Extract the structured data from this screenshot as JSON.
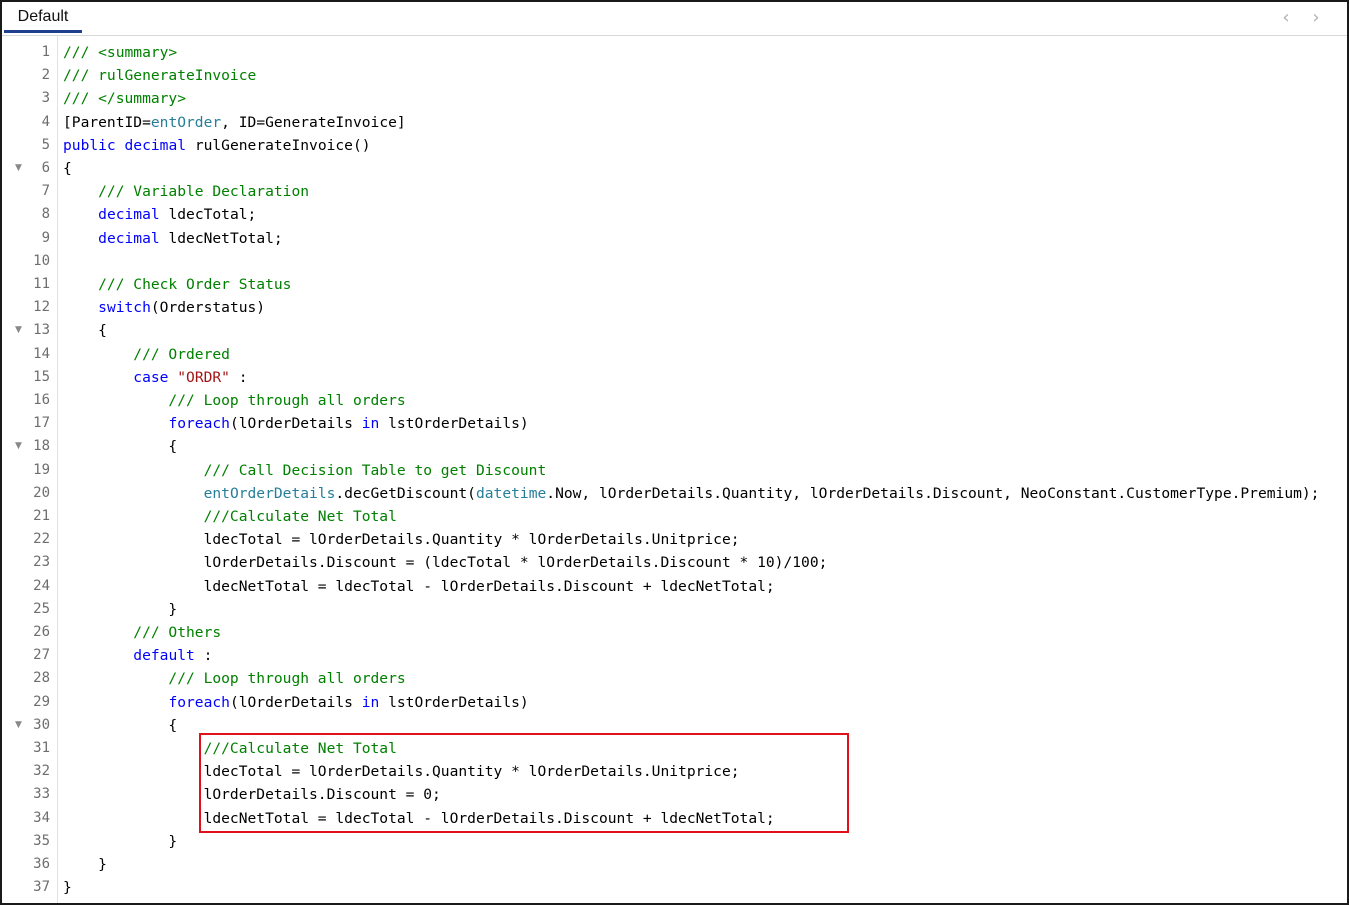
{
  "tab": {
    "label": "Default"
  },
  "nav": {
    "prev_icon": "chevron-left-icon",
    "next_icon": "chevron-right-icon"
  },
  "colors": {
    "comment": "#008000",
    "keyword": "#0000ff",
    "type": "#267f99",
    "string": "#a31515",
    "highlight_border": "#e0111b",
    "tab_underline": "#1f3f8f"
  },
  "lines": [
    {
      "n": "1",
      "fold": false,
      "tokens": [
        {
          "t": "/// <summary>",
          "c": "comment"
        }
      ]
    },
    {
      "n": "2",
      "fold": false,
      "tokens": [
        {
          "t": "/// rulGenerateInvoice",
          "c": "comment"
        }
      ]
    },
    {
      "n": "3",
      "fold": false,
      "tokens": [
        {
          "t": "/// </summary>",
          "c": "comment"
        }
      ]
    },
    {
      "n": "4",
      "fold": false,
      "tokens": [
        {
          "t": "[ParentID=",
          "c": "plain"
        },
        {
          "t": "entOrder",
          "c": "type"
        },
        {
          "t": ", ID=GenerateInvoice]",
          "c": "plain"
        }
      ]
    },
    {
      "n": "5",
      "fold": false,
      "tokens": [
        {
          "t": "public",
          "c": "keyword"
        },
        {
          "t": " ",
          "c": "plain"
        },
        {
          "t": "decimal",
          "c": "keyword"
        },
        {
          "t": " rulGenerateInvoice()",
          "c": "plain"
        }
      ]
    },
    {
      "n": "6",
      "fold": true,
      "tokens": [
        {
          "t": "{",
          "c": "plain"
        }
      ]
    },
    {
      "n": "7",
      "fold": false,
      "tokens": [
        {
          "t": "    /// Variable Declaration",
          "c": "comment"
        }
      ]
    },
    {
      "n": "8",
      "fold": false,
      "tokens": [
        {
          "t": "    ",
          "c": "plain"
        },
        {
          "t": "decimal",
          "c": "keyword"
        },
        {
          "t": " ldecTotal;",
          "c": "plain"
        }
      ]
    },
    {
      "n": "9",
      "fold": false,
      "tokens": [
        {
          "t": "    ",
          "c": "plain"
        },
        {
          "t": "decimal",
          "c": "keyword"
        },
        {
          "t": " ldecNetTotal;",
          "c": "plain"
        }
      ]
    },
    {
      "n": "10",
      "fold": false,
      "tokens": []
    },
    {
      "n": "11",
      "fold": false,
      "tokens": [
        {
          "t": "    /// Check Order Status",
          "c": "comment"
        }
      ]
    },
    {
      "n": "12",
      "fold": false,
      "tokens": [
        {
          "t": "    ",
          "c": "plain"
        },
        {
          "t": "switch",
          "c": "keyword"
        },
        {
          "t": "(Orderstatus)",
          "c": "plain"
        }
      ]
    },
    {
      "n": "13",
      "fold": true,
      "tokens": [
        {
          "t": "    {",
          "c": "plain"
        }
      ]
    },
    {
      "n": "14",
      "fold": false,
      "tokens": [
        {
          "t": "        /// Ordered",
          "c": "comment"
        }
      ]
    },
    {
      "n": "15",
      "fold": false,
      "tokens": [
        {
          "t": "        ",
          "c": "plain"
        },
        {
          "t": "case",
          "c": "keyword"
        },
        {
          "t": " ",
          "c": "plain"
        },
        {
          "t": "\"ORDR\"",
          "c": "string"
        },
        {
          "t": " :",
          "c": "plain"
        }
      ]
    },
    {
      "n": "16",
      "fold": false,
      "tokens": [
        {
          "t": "            /// Loop through all orders",
          "c": "comment"
        }
      ]
    },
    {
      "n": "17",
      "fold": false,
      "tokens": [
        {
          "t": "            ",
          "c": "plain"
        },
        {
          "t": "foreach",
          "c": "keyword"
        },
        {
          "t": "(lOrderDetails ",
          "c": "plain"
        },
        {
          "t": "in",
          "c": "keyword"
        },
        {
          "t": " lstOrderDetails)",
          "c": "plain"
        }
      ]
    },
    {
      "n": "18",
      "fold": true,
      "tokens": [
        {
          "t": "            {",
          "c": "plain"
        }
      ]
    },
    {
      "n": "19",
      "fold": false,
      "tokens": [
        {
          "t": "                /// Call Decision Table to get Discount",
          "c": "comment"
        }
      ]
    },
    {
      "n": "20",
      "fold": false,
      "tokens": [
        {
          "t": "                ",
          "c": "plain"
        },
        {
          "t": "entOrderDetails",
          "c": "type"
        },
        {
          "t": ".decGetDiscount(",
          "c": "plain"
        },
        {
          "t": "datetime",
          "c": "type"
        },
        {
          "t": ".Now, lOrderDetails.Quantity, lOrderDetails.Discount, NeoConstant.CustomerType.Premium);",
          "c": "plain"
        }
      ]
    },
    {
      "n": "21",
      "fold": false,
      "tokens": [
        {
          "t": "                ///Calculate Net Total",
          "c": "comment"
        }
      ]
    },
    {
      "n": "22",
      "fold": false,
      "tokens": [
        {
          "t": "                ldecTotal = lOrderDetails.Quantity * lOrderDetails.Unitprice;",
          "c": "plain"
        }
      ]
    },
    {
      "n": "23",
      "fold": false,
      "tokens": [
        {
          "t": "                lOrderDetails.Discount = (ldecTotal * lOrderDetails.Discount * 10)/100;",
          "c": "plain"
        }
      ]
    },
    {
      "n": "24",
      "fold": false,
      "tokens": [
        {
          "t": "                ldecNetTotal = ldecTotal - lOrderDetails.Discount + ldecNetTotal;",
          "c": "plain"
        }
      ]
    },
    {
      "n": "25",
      "fold": false,
      "tokens": [
        {
          "t": "            }",
          "c": "plain"
        }
      ]
    },
    {
      "n": "26",
      "fold": false,
      "tokens": [
        {
          "t": "        /// Others",
          "c": "comment"
        }
      ]
    },
    {
      "n": "27",
      "fold": false,
      "tokens": [
        {
          "t": "        ",
          "c": "plain"
        },
        {
          "t": "default",
          "c": "keyword"
        },
        {
          "t": " :",
          "c": "plain"
        }
      ]
    },
    {
      "n": "28",
      "fold": false,
      "tokens": [
        {
          "t": "            /// Loop through all orders",
          "c": "comment"
        }
      ]
    },
    {
      "n": "29",
      "fold": false,
      "tokens": [
        {
          "t": "            ",
          "c": "plain"
        },
        {
          "t": "foreach",
          "c": "keyword"
        },
        {
          "t": "(lOrderDetails ",
          "c": "plain"
        },
        {
          "t": "in",
          "c": "keyword"
        },
        {
          "t": " lstOrderDetails)",
          "c": "plain"
        }
      ]
    },
    {
      "n": "30",
      "fold": true,
      "tokens": [
        {
          "t": "            {",
          "c": "plain"
        }
      ]
    },
    {
      "n": "31",
      "fold": false,
      "tokens": [
        {
          "t": "                ///Calculate Net Total",
          "c": "comment"
        }
      ]
    },
    {
      "n": "32",
      "fold": false,
      "tokens": [
        {
          "t": "                ldecTotal = lOrderDetails.Quantity * lOrderDetails.Unitprice;",
          "c": "plain"
        }
      ]
    },
    {
      "n": "33",
      "fold": false,
      "tokens": [
        {
          "t": "                lOrderDetails.Discount = 0;",
          "c": "plain"
        }
      ]
    },
    {
      "n": "34",
      "fold": false,
      "tokens": [
        {
          "t": "                ldecNetTotal = ldecTotal - lOrderDetails.Discount + ldecNetTotal;",
          "c": "plain"
        }
      ]
    },
    {
      "n": "35",
      "fold": false,
      "tokens": [
        {
          "t": "            }",
          "c": "plain"
        }
      ]
    },
    {
      "n": "36",
      "fold": false,
      "tokens": [
        {
          "t": "    }",
          "c": "plain"
        }
      ]
    },
    {
      "n": "37",
      "fold": false,
      "tokens": [
        {
          "t": "}",
          "c": "plain"
        }
      ]
    }
  ]
}
